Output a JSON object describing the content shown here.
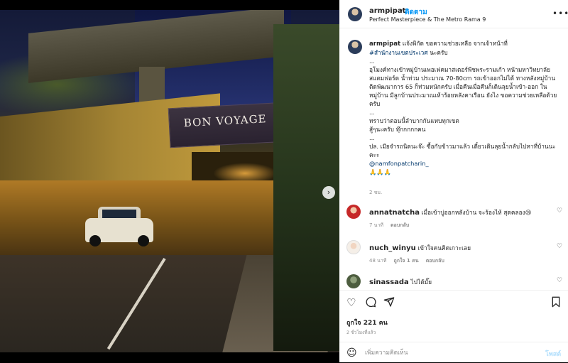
{
  "photo": {
    "billboard_text": "BON VOYAGE",
    "next_icon": "chevron-right-icon",
    "carousel_dots": 2,
    "active_dot": 1
  },
  "header": {
    "username": "armpipat",
    "separator": "•",
    "follow_label": "ติดตาม",
    "location": "Perfect Masterpiece & The Metro Rama 9",
    "more_icon": "more-icon"
  },
  "caption": {
    "username": "armpipat",
    "line1": " แจ้งพิกัด ขอความช่วยเหลือ จากเจ้าหน้าที่",
    "hashtag": "#สำนักงานเขตประเวศ",
    "line2": " นะครับ",
    "body1": "...\nอุโมงค์ทางเข้าหมู่บ้านเพอเฟคมาสเตอร์พีชพระรามเก้า หน้ามหาวิทยาลัยสแตมฟอร์ด น้ำท่วม ประมาณ 70-80cm รถเข้าออกไม่ได้ ทางหลังหมู่บ้านติดพัฒนาการ 65 ก็ท่วมหนักครับ เมื่อคืนเมื่อคืนก็เดินลุยน้ำเข้า-ออก ในหมู่บ้าน มีลูกบ้านประมาณเห้าร้อยหลังคาเรือน ยังไง ขอความช่วยเหลือด้วยครับ\n...\nทราบว่าตอนนี้ลำบากกันแทบทุกเขต\nสู้ๆนะครับ ทุ๊กกกกกคน\n...\nปล. เมียจำรถนิดนะจ๊ะ ซื้อกับข้าวมาแล้ว เดี๋ยวเดินลุยน้ำกลับไปหาที่บ้านนะคะะ\n",
    "mention": "@namfonpatcharin_",
    "body2": "\n🙏🙏🙏",
    "time": "2 ชม."
  },
  "comments": [
    {
      "username": "annatnatcha",
      "text": " เมื่อเข้าบู่ออกหลังบ้าน จะร้องไห้ สุดคลอง😢",
      "time": "7 นาที",
      "likes": "",
      "reply": "ตอบกลับ"
    },
    {
      "username": "nuch_winyu",
      "text": " เข้าใจคนคิดเกาะเลย",
      "time": "48 นาที",
      "likes": "ถูกใจ 1 คน",
      "reply": "ตอบกลับ"
    },
    {
      "username": "sinassada",
      "text": " ไปได้มั๊ย",
      "time": "",
      "likes": "",
      "reply": ""
    }
  ],
  "actions": {
    "like_icon": "heart-icon",
    "comment_icon": "comment-icon",
    "share_icon": "share-icon",
    "save_icon": "bookmark-icon",
    "likes_prefix": "ถูกใจ ",
    "likes_count": "221",
    "likes_suffix": " คน",
    "post_time": "2 ชั่วโมงที่แล้ว"
  },
  "add_comment": {
    "emoji_icon": "emoji-icon",
    "placeholder": "เพิ่มความคิดเห็น",
    "post_label": "โพสต์"
  }
}
